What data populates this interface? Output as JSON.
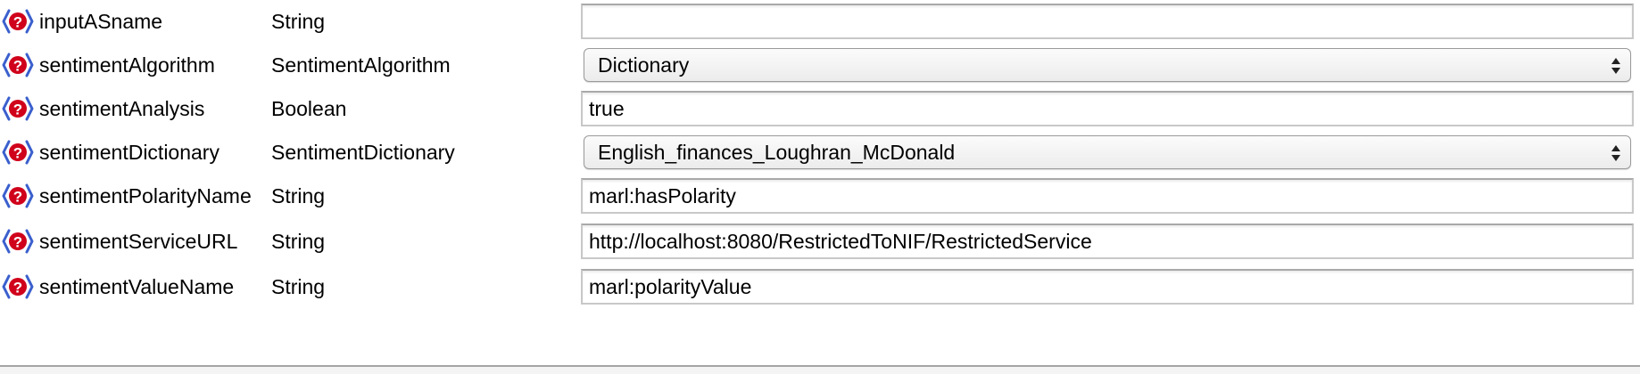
{
  "params": [
    {
      "name": "inputASname",
      "type": "String",
      "control": "text",
      "value": ""
    },
    {
      "name": "sentimentAlgorithm",
      "type": "SentimentAlgorithm",
      "control": "select",
      "value": "Dictionary"
    },
    {
      "name": "sentimentAnalysis",
      "type": "Boolean",
      "control": "text",
      "value": "true"
    },
    {
      "name": "sentimentDictionary",
      "type": "SentimentDictionary",
      "control": "select",
      "value": "English_finances_Loughran_McDonald"
    },
    {
      "name": "sentimentPolarityName",
      "type": "String",
      "control": "text",
      "value": "marl:hasPolarity"
    },
    {
      "name": "sentimentServiceURL",
      "type": "String",
      "control": "text",
      "value": "http://localhost:8080/RestrictedToNIF/RestrictedService"
    },
    {
      "name": "sentimentValueName",
      "type": "String",
      "control": "text",
      "value": "marl:polarityValue"
    }
  ],
  "icons": {
    "help": "help-icon"
  },
  "colors": {
    "help_icon_red": "#d0021b",
    "help_icon_blue": "#3a5fcd"
  }
}
